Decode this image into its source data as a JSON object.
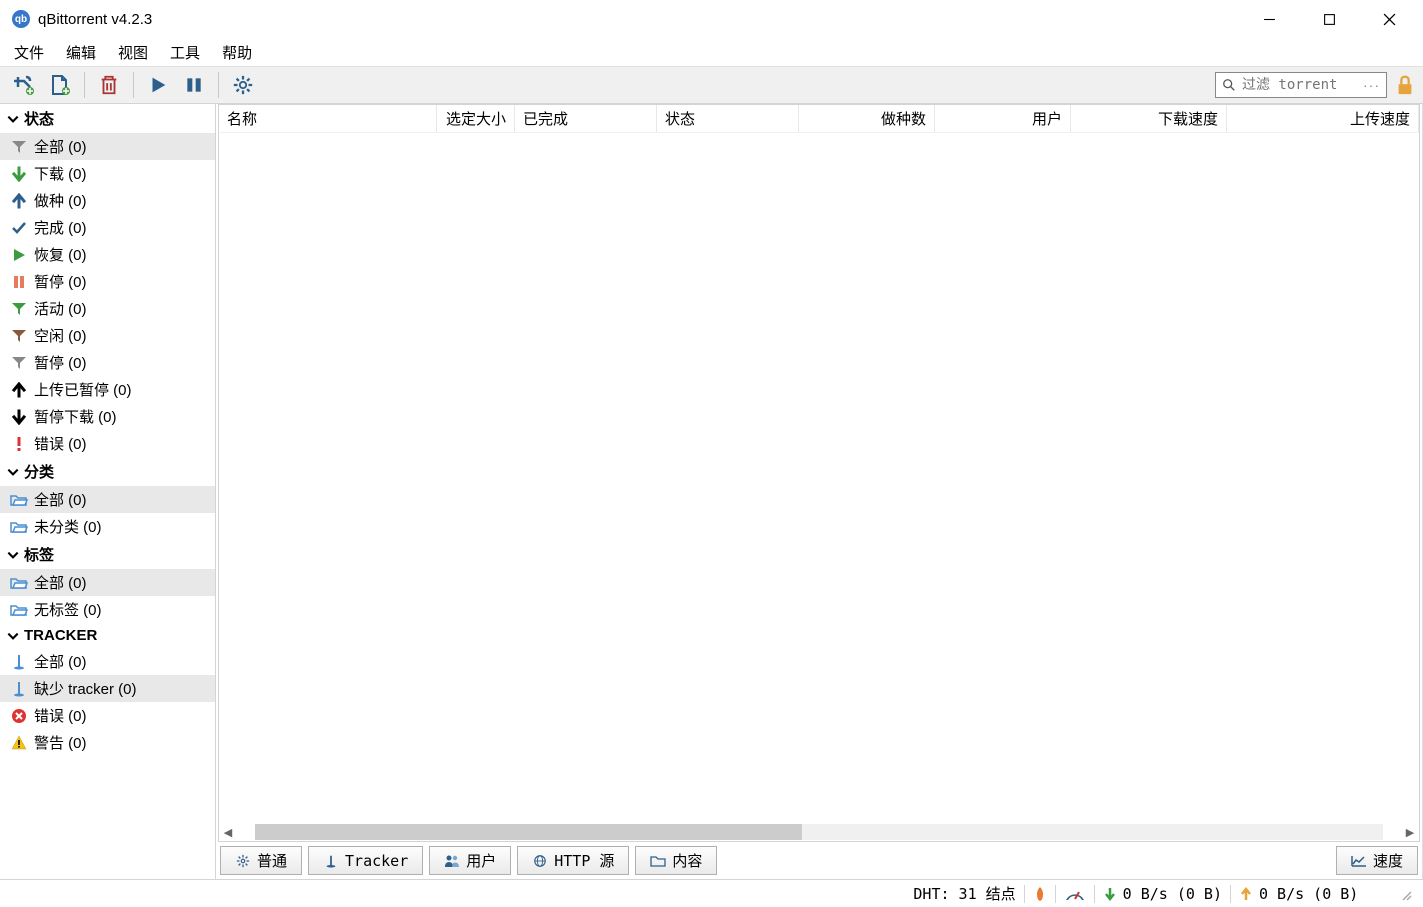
{
  "title": "qBittorrent v4.2.3",
  "menu": {
    "file": "文件",
    "edit": "编辑",
    "view": "视图",
    "tools": "工具",
    "help": "帮助"
  },
  "filter": {
    "placeholder": "过滤 torrent"
  },
  "sidebar": {
    "status": {
      "header": "状态",
      "items": [
        {
          "icon": "funnel-gray",
          "label": "全部 (0)",
          "selected": true
        },
        {
          "icon": "arrow-down-green",
          "label": "下载 (0)"
        },
        {
          "icon": "arrow-up-blue",
          "label": "做种 (0)"
        },
        {
          "icon": "check-blue",
          "label": "完成 (0)"
        },
        {
          "icon": "play-green",
          "label": "恢复 (0)"
        },
        {
          "icon": "pause-orange",
          "label": "暂停 (0)"
        },
        {
          "icon": "funnel-green",
          "label": "活动 (0)"
        },
        {
          "icon": "funnel-brown",
          "label": "空闲 (0)"
        },
        {
          "icon": "funnel-gray",
          "label": "暂停 (0)"
        },
        {
          "icon": "arrow-up-black",
          "label": "上传已暂停 (0)"
        },
        {
          "icon": "arrow-down-black",
          "label": "暂停下载 (0)"
        },
        {
          "icon": "exclaim-red",
          "label": "错误 (0)"
        }
      ]
    },
    "category": {
      "header": "分类",
      "items": [
        {
          "icon": "folder-open",
          "label": "全部 (0)",
          "selected": true
        },
        {
          "icon": "folder-open",
          "label": "未分类 (0)"
        }
      ]
    },
    "tags": {
      "header": "标签",
      "items": [
        {
          "icon": "folder-open",
          "label": "全部 (0)",
          "selected": true
        },
        {
          "icon": "folder-open",
          "label": "无标签 (0)"
        }
      ]
    },
    "tracker": {
      "header": "TRACKER",
      "items": [
        {
          "icon": "tracker-blue",
          "label": "全部 (0)"
        },
        {
          "icon": "tracker-blue",
          "label": "缺少 tracker (0)",
          "selected": true
        },
        {
          "icon": "x-red",
          "label": "错误 (0)"
        },
        {
          "icon": "warn-yellow",
          "label": "警告 (0)"
        }
      ]
    }
  },
  "columns": {
    "name": "名称",
    "size": "选定大小",
    "done": "已完成",
    "status": "状态",
    "seeds": "做种数",
    "peers": "用户",
    "dlspeed": "下载速度",
    "upspeed": "上传速度"
  },
  "bottom_tabs": {
    "general": "普通",
    "tracker": "Tracker",
    "peers": "用户",
    "http": "HTTP 源",
    "content": "内容",
    "speed": "速度"
  },
  "status": {
    "dht": "DHT: 31 结点",
    "dl": "0  B/s (0  B)",
    "ul": "0  B/s (0  B)"
  }
}
